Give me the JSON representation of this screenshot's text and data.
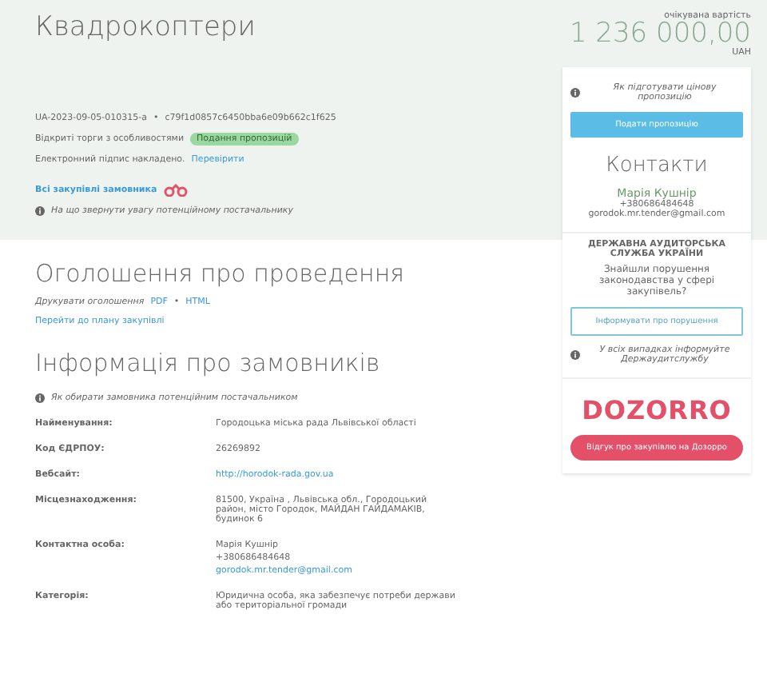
{
  "tender": {
    "title": "Квадрокоптери",
    "id": "UA-2023-09-05-010315-a",
    "separator": "•",
    "hash": "c79f1d0857c6450bba6e09b662c1f625",
    "procedure": "Відкриті торги з особливостями",
    "status": "Подання пропозицій",
    "signature": "Електронний підпис накладено.",
    "verify_link": "Перевірити",
    "all_purchases_link": "Всі закупівлі замовника",
    "attention_note": "На що звернути увагу потенційному постачальнику"
  },
  "price": {
    "label": "очікувана вартість",
    "amount": "1 236 000,00",
    "currency": "UAH"
  },
  "announcement": {
    "heading": "Оголошення про проведення",
    "print_label": "Друкувати оголошення",
    "links": [
      "PDF",
      "HTML"
    ],
    "separator": "•",
    "plan_link": "Перейти до плану закупівлі"
  },
  "customer": {
    "heading": "Інформація про замовників",
    "note": "Як обирати замовника потенційним постачальником",
    "rows": [
      {
        "label": "Найменування:",
        "lines": [
          {
            "text": "Городоцька міська рада Львівської області",
            "link": false
          }
        ]
      },
      {
        "label": "Код ЄДРПОУ:",
        "lines": [
          {
            "text": "26269892",
            "link": false
          }
        ]
      },
      {
        "label": "Вебсайт:",
        "lines": [
          {
            "text": "http://horodok-rada.gov.ua",
            "link": true
          }
        ]
      },
      {
        "label": "Місцезнаходження:",
        "lines": [
          {
            "text": "81500, Україна , Львівська обл., Городоцький район, місто Городок, МАЙДАН ГАЙДАМАКІВ, будинок 6",
            "link": false
          }
        ]
      },
      {
        "label": "Контактна особа:",
        "lines": [
          {
            "text": "Марія Кушнір",
            "link": false
          },
          {
            "text": "+380686484648",
            "link": false
          },
          {
            "text": "gorodok.mr.tender@gmail.com",
            "link": true
          }
        ]
      },
      {
        "label": "Категорія:",
        "lines": [
          {
            "text": "Юридична особа, яка забезпечує потреби держави або територіальної громади",
            "link": false
          }
        ]
      }
    ]
  },
  "sidebar": {
    "help": "Як підготувати цінову пропозицію",
    "submit_button": "Подати пропозицію",
    "contacts_heading": "Контакти",
    "contact_name": "Марія Кушнір",
    "contact_phone": "+380686484648",
    "contact_email": "gorodok.mr.tender@gmail.com",
    "audit_title": "ДЕРЖАВНА АУДИТОРСЬКА СЛУЖБА УКРАЇНИ",
    "audit_question": "Знайшли порушення законодавства у сфері закупівель?",
    "report_button": "Інформувати про порушення",
    "audit_note": "У всіх випадках інформуйте Держаудитслужбу",
    "logo": "DOZORRO",
    "dozorro_button": "Відгук про закупівлю на Дозорро"
  }
}
